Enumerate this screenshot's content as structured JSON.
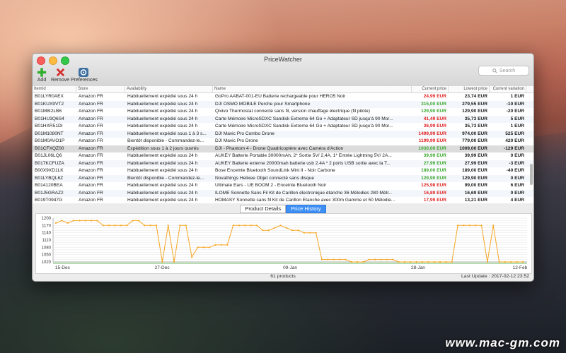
{
  "window": {
    "title": "PriceWatcher"
  },
  "toolbar": {
    "add_label": "Add",
    "remove_label": "Remove",
    "preferences_label": "Preferences"
  },
  "search": {
    "placeholder": "Search"
  },
  "columns": [
    "ItemId",
    "Store",
    "Availability",
    "Name",
    "Current price",
    "Lowest price",
    "Current variation"
  ],
  "rows": [
    [
      "B01LYR0AEX",
      "Amazon FR",
      "Habituellement expédié sous 24 h",
      "GoPro AABAT-001-EU Batterie rechargeable pour HERO5 Noir",
      "24,99 EUR",
      "23,74 EUR",
      "1 EUR",
      "red"
    ],
    [
      "B01KUX9VT2",
      "Amazon FR",
      "Habituellement expédié sous 24 h",
      "DJI OSMO MOBILE Perche pour Smartphone",
      "315,00 EUR",
      "279,55 EUR",
      "-10 EUR",
      "green"
    ],
    [
      "B01M8I2LB6",
      "Amazon FR",
      "Habituellement expédié sous 24 h",
      "Qivivo Thermostat connecté sans fil, version chauffage électrique (fil pilote)",
      "129,90 EUR",
      "129,90 EUR",
      "-20 EUR",
      "green"
    ],
    [
      "B01HU3Q6S4",
      "Amazon FR",
      "Habituellement expédié sous 24 h",
      "Carte Mémoire MicroSDXC Sandisk Extreme 64 Go + Adaptateur SD jusqu'à 90 Mo/...",
      "41,49 EUR",
      "35,73 EUR",
      "5 EUR",
      "red"
    ],
    [
      "B01HXR51DI",
      "Amazon FR",
      "Habituellement expédié sous 24 h",
      "Carte Mémoire MicroSDXC Sandisk Extreme 64 Go + Adaptateur SD jusqu'à 90 Mo/...",
      "36,99 EUR",
      "35,73 EUR",
      "1 EUR",
      "red"
    ],
    [
      "B01M1080NT",
      "Amazon FR",
      "Habituellement expédié sous 1 à 3 s...",
      "DJI Mavic Pro Combo Drone",
      "1499,99 EUR",
      "974,00 EUR",
      "525 EUR",
      "red"
    ],
    [
      "B01M0AVO1P",
      "Amazon FR",
      "Bientôt disponible - Commandez-le...",
      "DJI Mavic Pro Drone",
      "1199,99 EUR",
      "779,00 EUR",
      "420 EUR",
      "red"
    ],
    [
      "B01CFXQZ00",
      "Amazon FR",
      "Expédition sous 1 à 2 jours ouvrés",
      "DJI - Phantom 4 - Drone Quadricoptère avec Caméra d'Action",
      "1030,00 EUR",
      "1009,00 EUR",
      "-129 EUR",
      "green"
    ],
    [
      "B01JL06LQ6",
      "Amazon FR",
      "Habituellement expédié sous 24 h",
      "AUKEY Batterie Portable 30000mAh, 2* Sortie 5V/ 2,4A, 1* Entrée Lightning 5V/ 2A...",
      "39,99 EUR",
      "39,99 EUR",
      "0 EUR",
      "green"
    ],
    [
      "B017KCFUZA",
      "Amazon FR",
      "Habituellement expédié sous 24 h",
      "AUKEY Batterie externe 20000mah batterie usb 2.4A * 2 ports USB sortie avec la T...",
      "27,99 EUR",
      "27,99 EUR",
      "-3 EUR",
      "green"
    ],
    [
      "B00X9XD1LK",
      "Amazon FR",
      "Habituellement expédié sous 24 h",
      "Bose Enceinte Bluetooth SoundLink Mini II - Noir Carbone",
      "189,00 EUR",
      "189,00 EUR",
      "-40 EUR",
      "green"
    ],
    [
      "B01LYBQL6Z",
      "Amazon FR",
      "Bientôt disponible - Commandez-le...",
      "Novathings Helixee Objet connecté sans disque",
      "129,90 EUR",
      "129,90 EUR",
      "0 EUR",
      "green"
    ],
    [
      "B014120BEA",
      "Amazon FR",
      "Habituellement expédié sous 24 h",
      "Ultimate Ears - UE BOOM 2 - Enceinte Bluetooth Noir",
      "125,98 EUR",
      "99,00 EUR",
      "6 EUR",
      "red"
    ],
    [
      "B01J5GRAZ2",
      "Amazon FR",
      "Habituellement expédié sous 24 h",
      "ILOME Sonnette Sans Fil Kit de Carillon électronique étanche 36 Mélodies 280 Mètr...",
      "16,89 EUR",
      "16,69 EUR",
      "0 EUR",
      "red"
    ],
    [
      "B019T0947G",
      "Amazon FR",
      "Habituellement expédié sous 24 h",
      "HOMASY Sonnette sans fil Kit de Carillon Etanche avec 300m Gamme et 50 Mélodie...",
      "17,99 EUR",
      "13,21 EUR",
      "4 EUR",
      "red"
    ]
  ],
  "tabs": [
    "Product Details",
    "Price History"
  ],
  "chart_data": {
    "type": "line",
    "title": "",
    "xlabel": "",
    "ylabel": "",
    "ylim": [
      1020,
      1200
    ],
    "yticks": [
      1020,
      1030,
      1040,
      1050,
      1060,
      1070,
      1080,
      1090,
      1100,
      1110,
      1120,
      1130,
      1140,
      1150,
      1160,
      1170,
      1180,
      1190,
      1200
    ],
    "ytick_labels": [
      "1200",
      "1170",
      "1140",
      "1110",
      "1080",
      "1050",
      "1020"
    ],
    "xtick_labels": [
      "15-Dec",
      "27-Dec",
      "09-Jan",
      "28-Jan",
      "12-Feb"
    ],
    "xtick_positions": [
      0.02,
      0.23,
      0.5,
      0.77,
      0.985
    ],
    "series": [
      {
        "color": "#f5a623",
        "values": [
          1180,
          1190,
          1180,
          1190,
          1190,
          1190,
          1190,
          1190,
          1170,
          1170,
          1170,
          1170,
          1170,
          1190,
          1190,
          1170,
          1170,
          1170,
          1020,
          1170,
          1020,
          1170,
          1170,
          1040,
          1080,
          1080,
          1080,
          1090,
          1090,
          1090,
          1170,
          1170,
          1170,
          1170,
          1170,
          1150,
          1150,
          1160,
          1170,
          1160,
          1150,
          1150,
          1140,
          1140,
          1140,
          1030,
          1030,
          1030,
          1030,
          1030,
          1020,
          1020,
          1020,
          1030,
          1030,
          1030,
          1030,
          1030,
          1020,
          1020,
          1020,
          1020,
          1020,
          1020,
          1020,
          1020,
          1020,
          1020,
          1170,
          1170,
          1170,
          1170,
          1170,
          1020,
          1170,
          1020,
          1020,
          1020,
          1020,
          1020
        ],
        "reference_line": 1009
      }
    ]
  },
  "status": {
    "count": "61 products",
    "last_update": "Last Update : 2017-02-12 23:52"
  },
  "watermark": "www.mac-gm.com"
}
